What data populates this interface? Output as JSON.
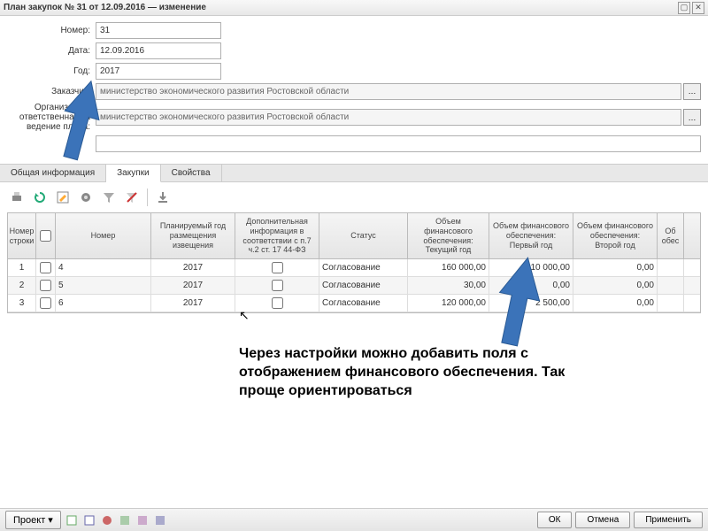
{
  "window": {
    "title": "План закупок № 31 от 12.09.2016 — изменение"
  },
  "form": {
    "number_label": "Номер:",
    "number_value": "31",
    "date_label": "Дата:",
    "date_value": "12.09.2016",
    "year_label": "Год:",
    "year_value": "2017",
    "customer_label": "Заказчик:",
    "customer_value": "министерство экономического развития Ростовской области",
    "org_label": "Организация, ответственная за ведение плана:",
    "org_value": "министерство экономического развития Ростовской области",
    "note_label": ""
  },
  "tabs": {
    "t1": "Общая информация",
    "t2": "Закупки",
    "t3": "Свойства"
  },
  "grid": {
    "headers": {
      "rownum": "Номер строки",
      "num": "Номер",
      "year": "Планируемый год размещения извещения",
      "info": "Дополнительная информация в соответствии с п.7 ч.2 ст. 17 44-ФЗ",
      "status": "Статус",
      "f1": "Объем финансового обеспечения: Текущий год",
      "f2": "Объем финансового обеспечения: Первый год",
      "f3": "Объем финансового обеспечения: Второй год",
      "f4": "Об обес"
    },
    "rows": [
      {
        "rn": "1",
        "num": "4",
        "year": "2017",
        "status": "Согласование",
        "f1": "160 000,00",
        "f2": "10 000,00",
        "f3": "0,00"
      },
      {
        "rn": "2",
        "num": "5",
        "year": "2017",
        "status": "Согласование",
        "f1": "30,00",
        "f2": "0,00",
        "f3": "0,00"
      },
      {
        "rn": "3",
        "num": "6",
        "year": "2017",
        "status": "Согласование",
        "f1": "120 000,00",
        "f2": "2 500,00",
        "f3": "0,00"
      }
    ]
  },
  "annotation": "Через настройки можно добавить поля с отображением финансового обеспечения. Так проще ориентироваться",
  "footer": {
    "project": "Проект",
    "ok": "ОК",
    "cancel": "Отмена",
    "apply": "Применить"
  }
}
